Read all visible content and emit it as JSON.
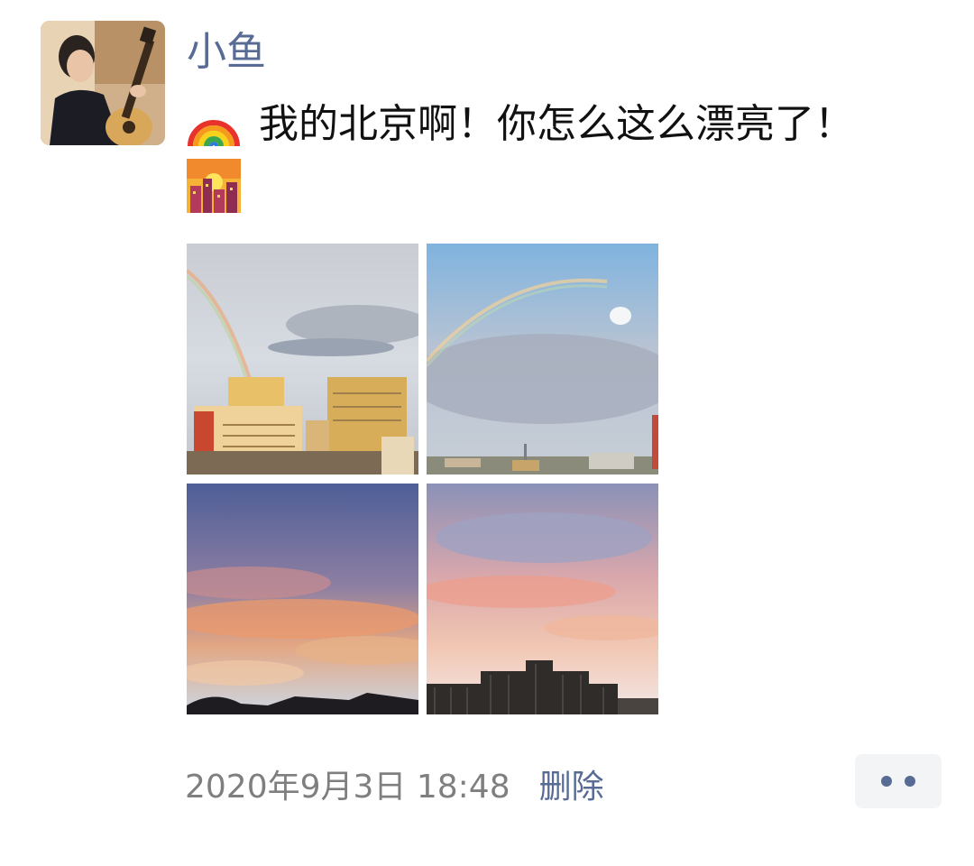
{
  "post": {
    "username": "小鱼",
    "text_line1": "我的北京啊！你怎么这么漂亮了！",
    "emojis": {
      "first": "rainbow-emoji",
      "second": "cityscape-at-dusk-emoji"
    },
    "photos": [
      {
        "icon": "rainbow-over-buildings-photo"
      },
      {
        "icon": "rainbow-over-skyline-photo"
      },
      {
        "icon": "sunset-clouds-photo"
      },
      {
        "icon": "sunset-clouds-building-photo"
      }
    ],
    "timestamp": "2020年9月3日 18:48",
    "delete_label": "删除",
    "more_icon": "more-dots-icon"
  },
  "colors": {
    "link": "#576b95",
    "text": "#111111",
    "timestamp": "#7f7f7f",
    "more_button_bg": "#f3f4f6"
  }
}
